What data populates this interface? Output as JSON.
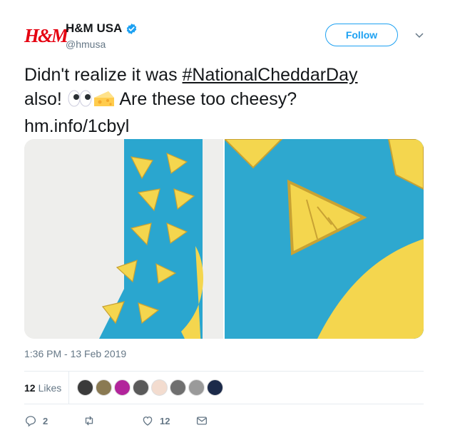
{
  "account": {
    "logo_text": "H&M",
    "display_name": "H&M USA",
    "handle": "@hmusa",
    "verified": true
  },
  "follow": {
    "label": "Follow"
  },
  "tweet": {
    "text_before": "Didn't realize it was ",
    "hashtag": "#NationalCheddarDay",
    "text_after": " also! ",
    "emojis": [
      "eyes-emoji",
      "cheese-emoji"
    ],
    "question": " Are these too cheesy?",
    "link": "hm.info/1cbyl"
  },
  "media": {
    "images": [
      "yellow-cheese-pattern-blue-sock-photo",
      "sock-closeup-photo"
    ]
  },
  "timestamp": "1:36 PM - 13 Feb 2019",
  "stats": {
    "likes_count": "12",
    "likes_label": "Likes"
  },
  "actions": {
    "replies": "2",
    "retweets": "",
    "likes": "12"
  },
  "colors": {
    "accent": "#1da1f2",
    "brand": "#e50010",
    "muted": "#657786"
  }
}
